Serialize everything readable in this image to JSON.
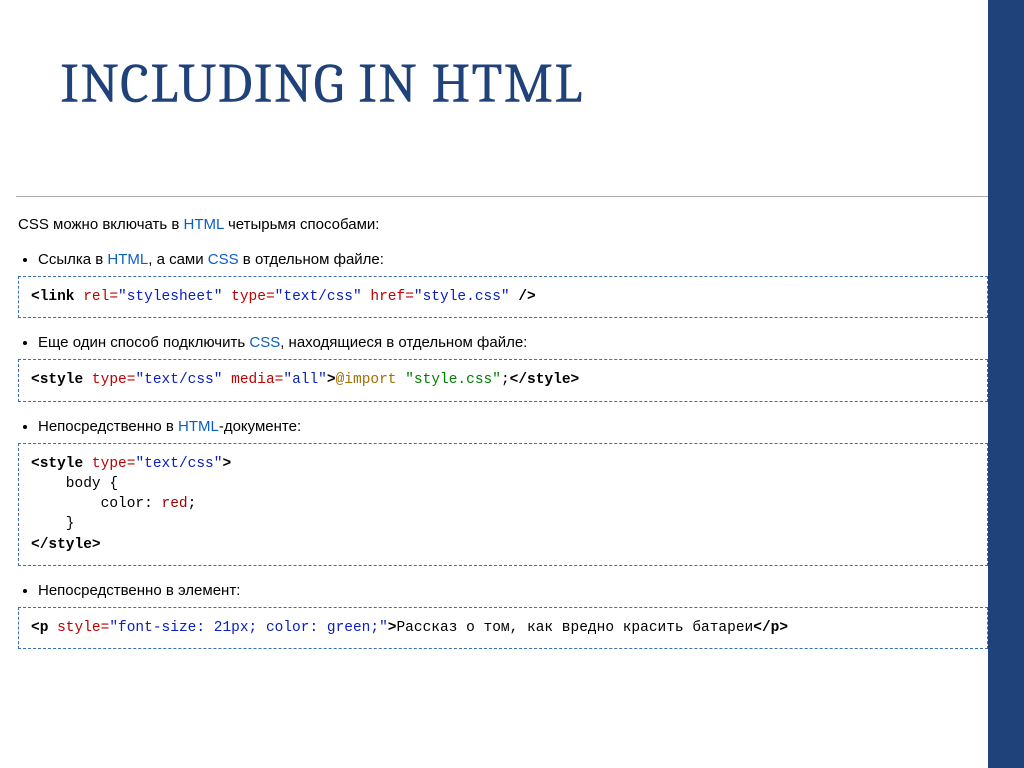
{
  "title": "INCLUDING IN HTML",
  "intro": {
    "p1": "CSS можно включать в ",
    "kw": "HTML",
    "p2": " четырьмя способами:"
  },
  "items": [
    {
      "text": {
        "p1": "Ссылка в ",
        "kw1": "HTML",
        "p2": ", а сами ",
        "kw2": "CSS",
        "p3": " в отдельном файле:"
      },
      "code": {
        "s1": "<link ",
        "s2": "rel=",
        "s3": "\"stylesheet\"",
        "s4": " type=",
        "s5": "\"text/css\"",
        "s6": " href=",
        "s7": "\"style.css\"",
        "s8": " />"
      }
    },
    {
      "text": {
        "p1": "Еще один способ подключить ",
        "kw1": "CSS",
        "p2": ", находящиеся в отдельном файле:"
      },
      "code": {
        "s1": "<style ",
        "s2": "type=",
        "s3": "\"text/css\"",
        "s4": " media=",
        "s5": "\"all\"",
        "s6": ">",
        "s7": "@import ",
        "s8": "\"style.css\"",
        "s9": ";",
        "s10": "</style>"
      }
    },
    {
      "text": {
        "p1": "Непосредственно в ",
        "kw1": "HTML",
        "p2": "-документе:"
      },
      "code": {
        "s1": "<style ",
        "s2": "type=",
        "s3": "\"text/css\"",
        "s4": ">",
        "b1": "    body {",
        "b2": "        color: ",
        "bv": "red",
        "b3": ";",
        "b4": "    }",
        "s5": "</style>"
      }
    },
    {
      "text": {
        "p1": "Непосредственно в элемент:"
      },
      "code": {
        "s1": "<p ",
        "s2": "style=",
        "s3": "\"font-size: 21px; color: green;\"",
        "s4": ">",
        "txt": "Рассказ о том, как вредно красить батареи",
        "s5": "</p>"
      }
    }
  ]
}
